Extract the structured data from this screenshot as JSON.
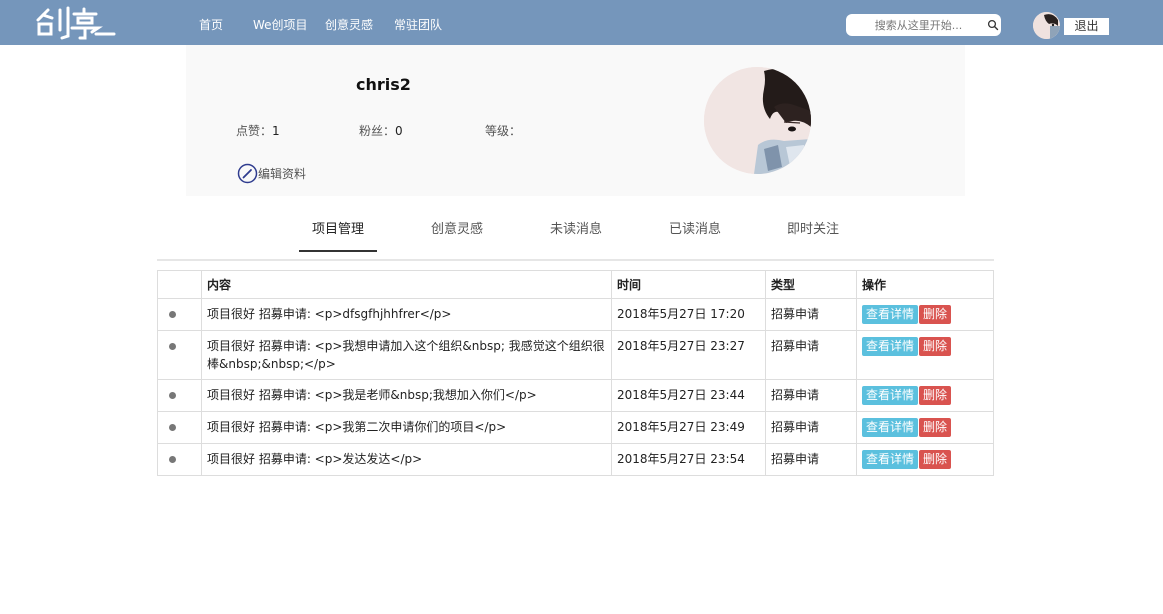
{
  "nav": {
    "logo_text": "创享",
    "items": [
      "首页",
      "We创项目",
      "创意灵感",
      "常驻团队"
    ],
    "search_placeholder": "搜索从这里开始...",
    "logout_label": "退出"
  },
  "profile": {
    "username": "chris2",
    "likes_label": "点赞：",
    "likes_value": "1",
    "fans_label": "粉丝：",
    "fans_value": "0",
    "level_label": "等级：",
    "level_value": "",
    "edit_label": "编辑资料"
  },
  "tabs": [
    "项目管理",
    "创意灵感",
    "未读消息",
    "已读消息",
    "即时关注"
  ],
  "table": {
    "headers": [
      "",
      "内容",
      "时间",
      "类型",
      "操作"
    ],
    "rows": [
      {
        "content": "项目很好 招募申请: <p>dfsgfhjhhfrer</p>",
        "time": "2018年5月27日 17:20",
        "type": "招募申请"
      },
      {
        "content": "项目很好 招募申请: <p>我想申请加入这个组织&nbsp; 我感觉这个组织很棒&nbsp;&nbsp;</p>",
        "time": "2018年5月27日 23:27",
        "type": "招募申请"
      },
      {
        "content": "项目很好 招募申请: <p>我是老师&nbsp;我想加入你们</p>",
        "time": "2018年5月27日 23:44",
        "type": "招募申请"
      },
      {
        "content": "项目很好 招募申请: <p>我第二次申请你们的项目</p>",
        "time": "2018年5月27日 23:49",
        "type": "招募申请"
      },
      {
        "content": "项目很好 招募申请: <p>发达发达</p>",
        "time": "2018年5月27日 23:54",
        "type": "招募申请"
      }
    ],
    "detail_label": "查看详情",
    "delete_label": "删除"
  },
  "colors": {
    "nav_bg": "#7596bb",
    "detail_btn": "#5bc0de",
    "delete_btn": "#d9534f"
  }
}
